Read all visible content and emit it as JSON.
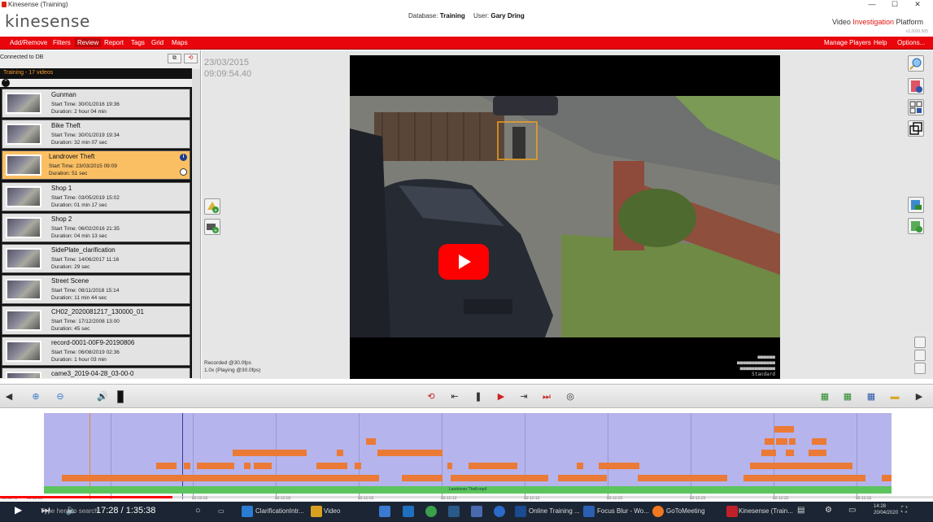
{
  "window": {
    "title": "Kinesense (Training)",
    "minimize": "—",
    "maximize": "☐",
    "close": "✕"
  },
  "header": {
    "logo": "kinesense",
    "database_label": "Database:",
    "database_value": "Training",
    "user_label": "User:",
    "user_value": "Gary Dring",
    "platform_prefix": "Video",
    "platform_red": "Investigation",
    "platform_suffix": "Platform",
    "version": "v3.2020.505"
  },
  "menu": {
    "left": [
      "Add/Remove",
      "Filters",
      "Review",
      "Report",
      "Tags",
      "Grid",
      "Maps"
    ],
    "right": [
      "Manage Players",
      "Help",
      "Options..."
    ]
  },
  "left_panel": {
    "connection_status": "Connected to DB",
    "group_header": "Training - 17 videos",
    "videos": [
      {
        "title": "Gunman",
        "start": "Start Time: 30/01/2016 19:36",
        "duration": "Duration: 2 hour 04 min"
      },
      {
        "title": "Bike Theft",
        "start": "Start Time: 30/01/2019 19:34",
        "duration": "Duration: 32 min 07 sec"
      },
      {
        "title": "Landrover Theft",
        "start": "Start Time: 23/03/2015 09:09",
        "duration": "Duration: 51 sec"
      },
      {
        "title": "Shop 1",
        "start": "Start Time: 03/05/2019 15:02",
        "duration": "Duration: 01 min 17 sec"
      },
      {
        "title": "Shop 2",
        "start": "Start Time: 06/02/2016 21:35",
        "duration": "Duration: 04 min 13 sec"
      },
      {
        "title": "SidePlate_clarification",
        "start": "Start Time: 14/06/2017 11:16",
        "duration": "Duration: 29 sec"
      },
      {
        "title": "Street Scene",
        "start": "Start Time: 08/11/2018 15:14",
        "duration": "Duration: 11 min 44 sec"
      },
      {
        "title": "CH02_2020081217_130000_01",
        "start": "Start Time: 17/12/2008 13:00",
        "duration": "Duration: 45 sec"
      },
      {
        "title": "record-0001-00F9-20190806",
        "start": "Start Time: 06/08/2019 02:36",
        "duration": "Duration: 1 hour 03 min"
      },
      {
        "title": "came3_2019-04-28_03-00-0",
        "start": "",
        "duration": ""
      }
    ],
    "selected_index": 2
  },
  "player": {
    "date": "23/03/2015",
    "time": "09:09:54.40",
    "recorded": "Recorded @30.0fps",
    "playing": "1.0x (Playing @30.0fps)",
    "watermark_line4": "Standard"
  },
  "timeline": {
    "track_label": "Landrover Theft.mp4",
    "tick_labels": [
      "09:09:49",
      "09:09:50",
      "09:09:55",
      "09:10:00",
      "09:10:05",
      "09:10:10",
      "09:10:15",
      "09:10:20",
      "09:10:25",
      "09:10:30",
      "09:10:35"
    ],
    "played_fraction": 0.185
  },
  "youtube": {
    "time": "17:28 / 1:35:38"
  },
  "taskbar": {
    "search": "Type here to search",
    "apps": [
      "ClarificationIntr...",
      "Video",
      "Online Training ...",
      "Focus Blur - Wo...",
      "GoToMeeting",
      "Kinesense (Train..."
    ],
    "clock_time": "14:28",
    "clock_date": "20/04/2020"
  },
  "colors": {
    "menu_red": "#e8060c",
    "selected_item": "#fbbf63",
    "timeline_band": "#b6b4ec",
    "timeline_segment": "#ea7a36",
    "track_green": "#5cc45c",
    "taskbar": "#1b2533"
  }
}
